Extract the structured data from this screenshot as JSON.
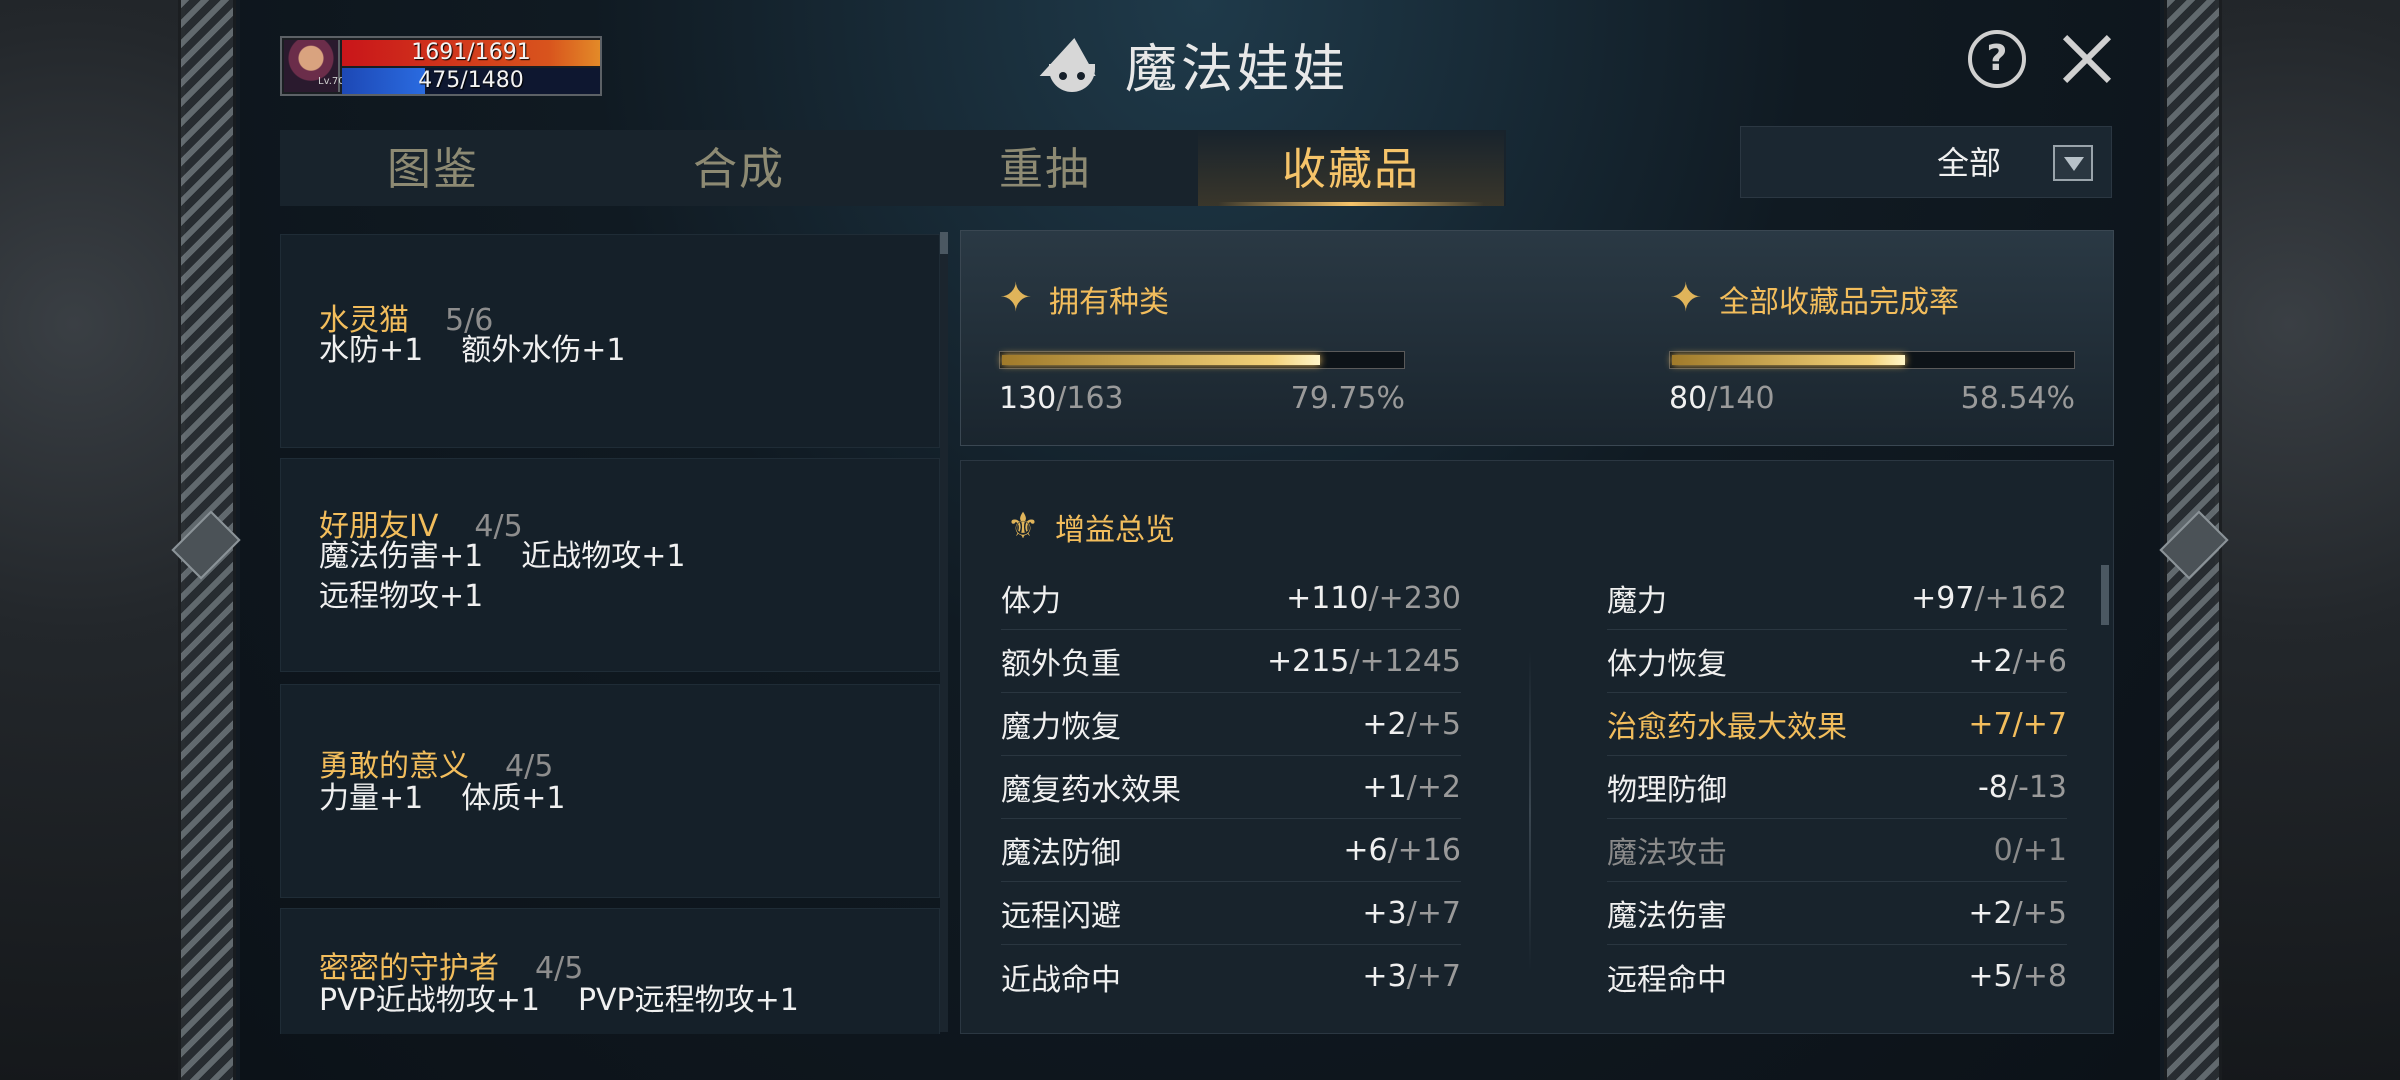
{
  "player": {
    "level": "Lv.70",
    "hp_text": "1691/1691",
    "hp_fraction": 1.0,
    "mp_text": "475/1480",
    "mp_fraction": 0.32
  },
  "header": {
    "title": "魔法娃娃",
    "help_icon": "question-circle-icon",
    "close_icon": "close-icon"
  },
  "tabs": [
    {
      "label": "图鉴",
      "active": false
    },
    {
      "label": "合成",
      "active": false
    },
    {
      "label": "重抽",
      "active": false
    },
    {
      "label": "收藏品",
      "active": true
    }
  ],
  "filter": {
    "selected": "全部"
  },
  "collections": [
    {
      "name": "水灵猫",
      "count": "5/6",
      "effects": [
        "水防+1",
        "额外水伤+1"
      ]
    },
    {
      "name": "好朋友IV",
      "count": "4/5",
      "effects": [
        "魔法伤害+1",
        "近战物攻+1",
        "远程物攻+1"
      ]
    },
    {
      "name": "勇敢的意义",
      "count": "4/5",
      "effects": [
        "力量+1",
        "体质+1"
      ]
    },
    {
      "name": "密密的守护者",
      "count": "4/5",
      "effects": [
        "PVP近战物攻+1",
        "PVP远程物攻+1"
      ]
    }
  ],
  "stats": {
    "owned": {
      "title": "拥有种类",
      "current": "130",
      "total": "/163",
      "percent": "79.75%",
      "fraction": 0.7975
    },
    "completion": {
      "title": "全部收藏品完成率",
      "current": "80",
      "total": "/140",
      "percent": "58.54%",
      "fraction": 0.5854
    }
  },
  "buff_overview": {
    "title": "增益总览",
    "left": [
      {
        "name": "体力",
        "value": "+110",
        "max": "/+230"
      },
      {
        "name": "额外负重",
        "value": "+215",
        "max": "/+1245"
      },
      {
        "name": "魔力恢复",
        "value": "+2",
        "max": "/+5"
      },
      {
        "name": "魔复药水效果",
        "value": "+1",
        "max": "/+2"
      },
      {
        "name": "魔法防御",
        "value": "+6",
        "max": "/+16"
      },
      {
        "name": "远程闪避",
        "value": "+3",
        "max": "/+7"
      },
      {
        "name": "近战命中",
        "value": "+3",
        "max": "/+7"
      }
    ],
    "right": [
      {
        "name": "魔力",
        "value": "+97",
        "max": "/+162"
      },
      {
        "name": "体力恢复",
        "value": "+2",
        "max": "/+6"
      },
      {
        "name": "治愈药水最大效果",
        "value": "+7",
        "max": "/+7"
      },
      {
        "name": "物理防御",
        "value": "-8",
        "max": "/-13"
      },
      {
        "name": "魔法攻击",
        "value": "0",
        "max": "/+1"
      },
      {
        "name": "魔法伤害",
        "value": "+2",
        "max": "/+5"
      },
      {
        "name": "远程命中",
        "value": "+5",
        "max": "/+8"
      }
    ]
  },
  "colors": {
    "accent_gold": "#f2bd5c",
    "hp_red": "#c9151a",
    "mp_blue": "#2a6be0"
  }
}
